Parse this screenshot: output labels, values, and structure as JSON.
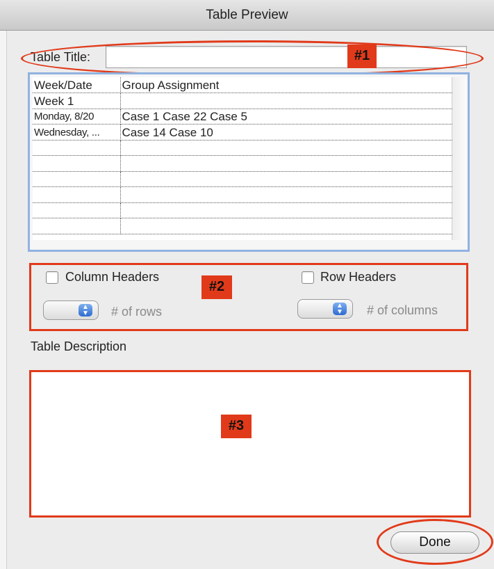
{
  "window": {
    "title": "Table Preview"
  },
  "title_field": {
    "label": "Table Title:",
    "value": ""
  },
  "annotations": {
    "badge1": "#1",
    "badge2": "#2",
    "badge3": "#3"
  },
  "table": {
    "rows": [
      [
        "Week/Date",
        "Group Assignment"
      ],
      [
        "Week 1",
        ""
      ],
      [
        "Monday, 8/20",
        "Case 1 Case 22 Case 5"
      ],
      [
        "Wednesday, ...",
        "Case 14 Case 10"
      ],
      [
        "",
        ""
      ],
      [
        "",
        ""
      ],
      [
        "",
        ""
      ],
      [
        "",
        ""
      ],
      [
        "",
        ""
      ],
      [
        "",
        ""
      ]
    ]
  },
  "headers": {
    "column_headers_label": "Column Headers",
    "row_headers_label": "Row Headers",
    "rows_label": "# of rows",
    "columns_label": "# of columns"
  },
  "description": {
    "heading": "Table Description",
    "value": ""
  },
  "done_button": {
    "label": "Done"
  },
  "colors": {
    "annotation_red": "#e13a1a",
    "table_focus_blue": "#8fb3e0"
  }
}
